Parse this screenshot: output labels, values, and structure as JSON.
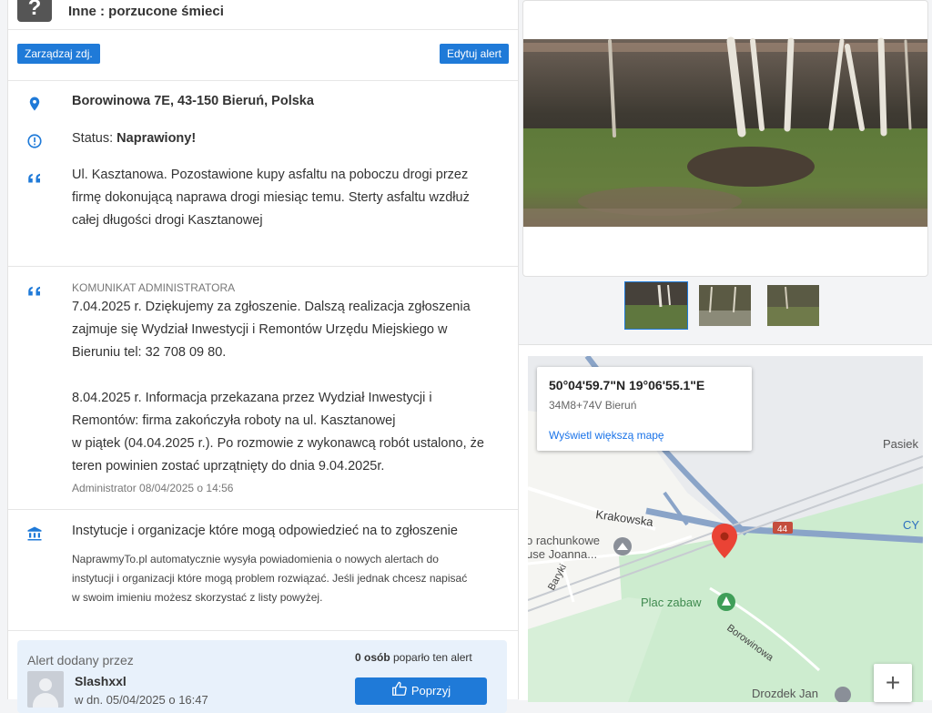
{
  "category": {
    "text": "Inne : porzucone śmieci",
    "icon": "question-icon"
  },
  "buttons": {
    "manage_photos": "Zarządzaj zdj.",
    "edit_alert": "Edytuj alert",
    "support": "Poprzyj"
  },
  "alert": {
    "address": "Borowinowa 7E, 43-150 Bieruń, Polska",
    "status_label": "Status: ",
    "status_value": "Naprawiony!",
    "description_lines": [
      "Ul. Kasztanowa. Pozostawione kupy asfaltu na poboczu drogi przez",
      "firmę dokonującą naprawa drogi miesiąc temu. Sterty asfaltu wzdłuż",
      "całej długości drogi Kasztanowej"
    ]
  },
  "admin": {
    "label": "KOMUNIKAT ADMINISTRATORA",
    "lines": [
      "7.04.2025 r. Dziękujemy za zgłoszenie. Dalszą realizacja zgłoszenia",
      "zajmuje się Wydział Inwestycji i Remontów Urzędu Miejskiego w",
      "Bieruniu tel: 32 708 09 80.",
      "",
      "8.04.2025 r. Informacja przekazana przez Wydział Inwestycji i",
      "Remontów: firma zakończyła roboty na ul. Kasztanowej",
      "w piątek (04.04.2025 r.). Po rozmowie z wykonawcą robót ustalono, że",
      "teren powinien zostać uprzątnięty do dnia 9.04.2025r."
    ],
    "signature": "Administrator 08/04/2025 o 14:56"
  },
  "institutions": {
    "title": "Instytucje i organizacje które mogą odpowiedzieć na to zgłoszenie",
    "lines": [
      "NaprawmyTo.pl automatycznie wysyła powiadomienia o nowych alertach do",
      "instytucji i organizacji które mogą problem rozwiązać. Jeśli jednak chcesz napisać",
      "w swoim imieniu możesz skorzystać z listy powyżej."
    ]
  },
  "author": {
    "label": "Alert dodany przez",
    "name": "Slashxxl",
    "date": "w dn. 05/04/2025 o 16:47",
    "supporters_count": "0 osób",
    "supporters_suffix": " poparło ten alert"
  },
  "map": {
    "coords": "50°04'59.7\"N 19°06'55.1\"E",
    "pluscode": "34M8+74V Bieruń",
    "link": "Wyświetl większą mapę",
    "labels": {
      "krakowska": "Krakowska",
      "road_no": "44",
      "rachunkowe1": "o rachunkowe",
      "rachunkowe2": "use Joanna...",
      "baryki": "Baryki",
      "plac": "Plac zabaw",
      "borowinowa": "Borowinowa",
      "drozdek": "Drozdek Jan",
      "pasiek": "Pasiek",
      "cy": "CY"
    },
    "zoom_in": "+"
  },
  "colors": {
    "accent": "#1f7ad8",
    "map_green": "#cdeccf",
    "pin": "#ea4335"
  }
}
